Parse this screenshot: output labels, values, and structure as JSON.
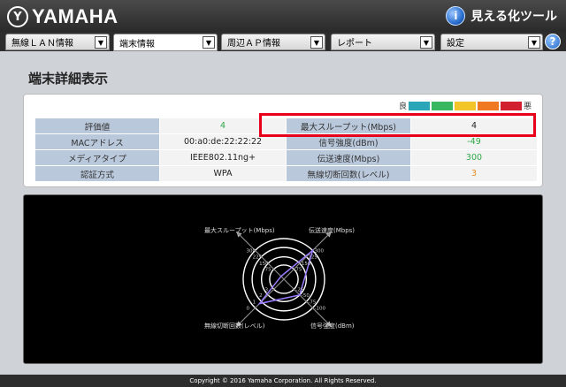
{
  "header": {
    "brand": "YAMAHA",
    "brand_mark": "Y",
    "tool_title": "見える化ツール",
    "tool_icon_letter": "i"
  },
  "tabs": [
    {
      "label": "無線ＬＡＮ情報"
    },
    {
      "label": "端末情報"
    },
    {
      "label": "周辺ＡＰ情報"
    },
    {
      "label": "レポート"
    },
    {
      "label": "設定"
    }
  ],
  "help_label": "?",
  "page_title": "端末詳細表示",
  "legend": {
    "good": "良",
    "bad": "悪",
    "colors": [
      "#2aa6b8",
      "#3ab861",
      "#f2c62a",
      "#f07a22",
      "#d2202e"
    ]
  },
  "info": {
    "rows": [
      {
        "l1": "評価値",
        "v1": "4",
        "l2": "最大スループット(Mbps)",
        "v2": "4"
      },
      {
        "l1": "MACアドレス",
        "v1": "00:a0:de:22:22:22",
        "l2": "信号強度(dBm)",
        "v2": "-49"
      },
      {
        "l1": "メディアタイプ",
        "v1": "IEEE802.11ng+",
        "l2": "伝送速度(Mbps)",
        "v2": "300"
      },
      {
        "l1": "認証方式",
        "v1": "WPA",
        "l2": "無線切断回数(レベル)",
        "v2": "3"
      }
    ]
  },
  "radar": {
    "labels": {
      "top_left": "最大スループット(Mbps)",
      "top_right": "伝送速度(Mbps)",
      "bottom_left": "無線切断回数(レベル)",
      "bottom_right": "信号強度(dBm)"
    },
    "ticks": {
      "throughput": [
        "300",
        "225",
        "150",
        "75"
      ],
      "rate": [
        "300",
        "225",
        "150",
        "75"
      ],
      "signal": [
        "-100",
        "-75",
        "-50",
        "-25"
      ],
      "disconnect": [
        "0",
        "1",
        "2",
        "3"
      ]
    },
    "values": {
      "throughput": 0.1,
      "rate": 1.0,
      "signal": 0.55,
      "disconnect": 0.85
    }
  },
  "footer": "Copyright © 2016 Yamaha Corporation. All Rights Reserved."
}
